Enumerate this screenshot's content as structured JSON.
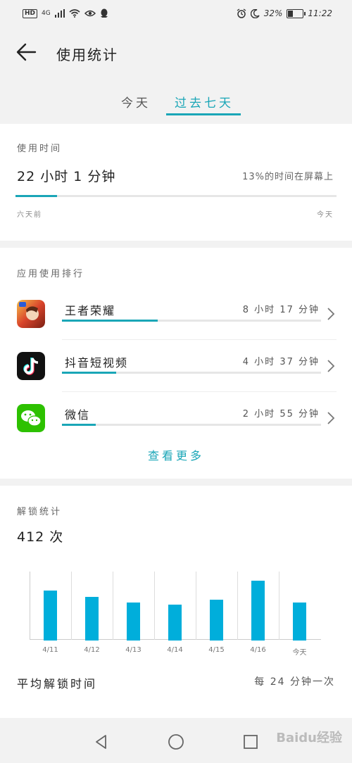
{
  "status_bar": {
    "hd": "HD",
    "network": "4G",
    "battery_pct": "32%",
    "battery_level": 0.32,
    "time": "11:22"
  },
  "header": {
    "title": "使用统计"
  },
  "tabs": [
    {
      "label": "今天",
      "active": false
    },
    {
      "label": "过去七天",
      "active": true
    }
  ],
  "usage": {
    "label": "使用时间",
    "value": "22 小时 1 分钟",
    "screen_note": "13%的时间在屏幕上",
    "screen_fraction": 0.13,
    "start": "六天前",
    "end": "今天"
  },
  "ranking": {
    "label": "应用使用排行",
    "apps": [
      {
        "name": "王者荣耀",
        "time": "8 小时 17 分钟",
        "fraction": 0.37,
        "icon": "honor-of-kings-icon"
      },
      {
        "name": "抖音短视频",
        "time": "4 小时 37 分钟",
        "fraction": 0.21,
        "icon": "douyin-icon"
      },
      {
        "name": "微信",
        "time": "2 小时 55 分钟",
        "fraction": 0.13,
        "icon": "wechat-icon"
      }
    ],
    "see_more": "查看更多"
  },
  "unlock": {
    "label": "解锁统计",
    "count": "412 次",
    "avg_label": "平均解锁时间",
    "avg_value": "每 24 分钟一次"
  },
  "chart_data": {
    "type": "bar",
    "categories": [
      "4/11",
      "4/12",
      "4/13",
      "4/14",
      "4/15",
      "4/16",
      "今天"
    ],
    "values": [
      74,
      65,
      56,
      53,
      60,
      89,
      56
    ],
    "ylim": [
      0,
      100
    ],
    "grid": "vertical",
    "bar_color": "#00aedb"
  },
  "colors": {
    "accent": "#1aa6b7",
    "bar": "#00aedb"
  },
  "watermark": "Baidu经验"
}
